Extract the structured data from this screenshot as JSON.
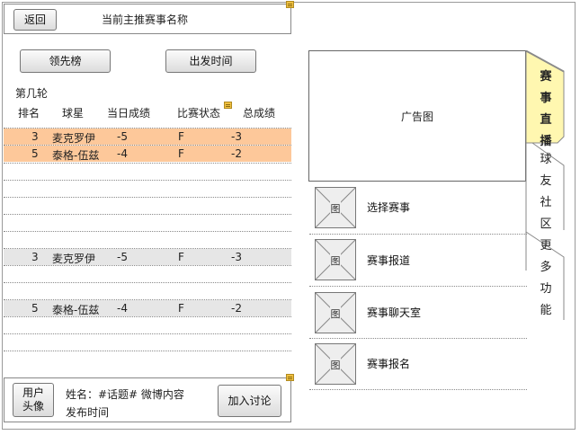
{
  "header": {
    "back_label": "返回",
    "title": "当前主推赛事名称"
  },
  "toolbar": {
    "leaderboard_label": "领先榜",
    "start_time_label": "出发时间"
  },
  "table": {
    "round_label": "第几轮",
    "columns": [
      "排名",
      "球星",
      "当日成绩",
      "比赛状态",
      "总成绩"
    ],
    "highlighted_rows": [
      {
        "rank": "3",
        "player": "麦克罗伊",
        "today": "-5",
        "status": "F",
        "total": "-3"
      },
      {
        "rank": "5",
        "player": "泰格-伍兹",
        "today": "-4",
        "status": "F",
        "total": "-2"
      }
    ],
    "rows": [
      {
        "rank": "3",
        "player": "麦克罗伊",
        "today": "-5",
        "status": "F",
        "total": "-3"
      },
      {
        "rank": "5",
        "player": "泰格-伍兹",
        "today": "-4",
        "status": "F",
        "total": "-2"
      }
    ]
  },
  "comment": {
    "avatar_label_line1": "用户",
    "avatar_label_line2": "头像",
    "name_line": "姓名：#话题# 微博内容",
    "time_line": "发布时间",
    "join_label": "加入讨论"
  },
  "ad": {
    "label": "广告图"
  },
  "menu": {
    "image_placeholder": "图",
    "items": [
      {
        "label": "选择赛事"
      },
      {
        "label": "赛事报道"
      },
      {
        "label": "赛事聊天室"
      },
      {
        "label": "赛事报名"
      }
    ]
  },
  "tabs": [
    {
      "chars": [
        "赛",
        "事",
        "直",
        "播"
      ],
      "active": true
    },
    {
      "chars": [
        "球",
        "友",
        "社",
        "区"
      ],
      "active": false
    },
    {
      "chars": [
        "更",
        "多",
        "功",
        "能"
      ],
      "active": false
    }
  ],
  "colors": {
    "highlight_row": "#fdc89a",
    "gray_row": "#e6e6e6",
    "active_tab": "#fff7b0"
  }
}
